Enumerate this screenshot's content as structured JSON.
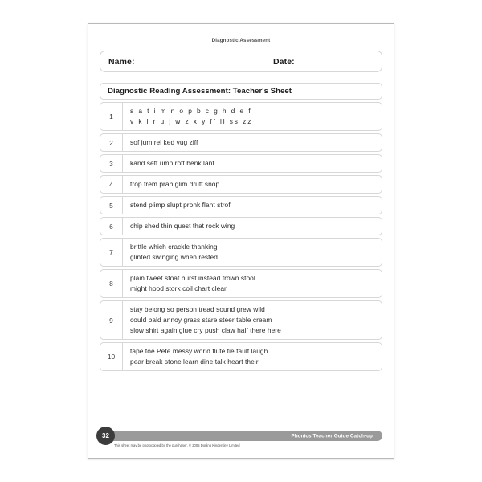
{
  "document": {
    "header_label": "Diagnostic Assessment",
    "title": "Diagnostic Reading Assessment: Teacher's Sheet"
  },
  "fields": {
    "name_label": "Name:",
    "date_label": "Date:"
  },
  "rows": [
    {
      "number": "1",
      "lines": [
        "s a t i m n o p b c g h d e f",
        "v k l r u j w z x y ff ll ss zz"
      ],
      "style": "letters"
    },
    {
      "number": "2",
      "lines": [
        "sof   jum   rel   ked   vug   ziff"
      ],
      "style": "words"
    },
    {
      "number": "3",
      "lines": [
        "kand   seft   ump   roft   benk   lant"
      ],
      "style": "words"
    },
    {
      "number": "4",
      "lines": [
        "trop   frem   prab   glim   druff   snop"
      ],
      "style": "words"
    },
    {
      "number": "5",
      "lines": [
        "stend   plimp   slupt   pronk   flant   strof"
      ],
      "style": "words"
    },
    {
      "number": "6",
      "lines": [
        "chip   shed   thin   quest   that   rock   wing"
      ],
      "style": "words"
    },
    {
      "number": "7",
      "lines": [
        "brittle   which   crackle   thanking",
        "glinted   swinging   when   rested"
      ],
      "style": "words"
    },
    {
      "number": "8",
      "lines": [
        "plain   tweet   stoat   burst   instead   frown   stool",
        "might   hood   stork   coil   chart   clear"
      ],
      "style": "words"
    },
    {
      "number": "9",
      "lines": [
        "stay   belong   so   person   tread   sound   grew   wild",
        "could   bald   annoy   grass   stare   steer   table   cream",
        "slow   shirt   again   glue   cry   push   claw   half   there   here"
      ],
      "style": "words"
    },
    {
      "number": "10",
      "lines": [
        "tape   toe   Pete   messy   world   flute   tie   fault   laugh",
        "pear   break   stone   learn   dine   talk   heart   their"
      ],
      "style": "words"
    }
  ],
  "footer": {
    "page_number": "32",
    "bar_text": "Phonics Teacher Guide Catch-up",
    "copyright_note": "This sheet may be photocopied by the purchaser. © 2005 Dorling Kindersley Limited"
  },
  "colors": {
    "bar_gray": "#9a9a9a",
    "badge_dark": "#3c3c3c",
    "border_gray": "#d7d7d7",
    "text_dark": "#1d1d1d"
  }
}
